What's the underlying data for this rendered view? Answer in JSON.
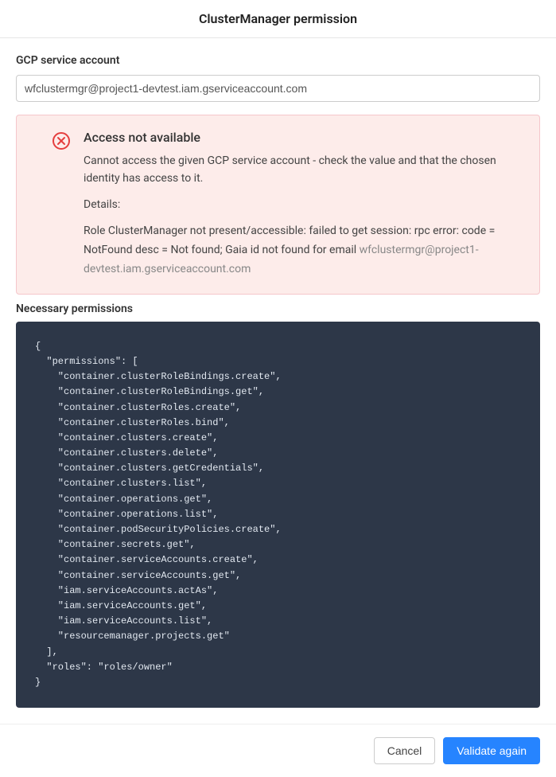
{
  "dialog": {
    "title": "ClusterManager permission"
  },
  "serviceAccount": {
    "label": "GCP service account",
    "value": "wfclustermgr@project1-devtest.iam.gserviceaccount.com"
  },
  "alert": {
    "title": "Access not available",
    "message": "Cannot access the given GCP service account - check the value and that the chosen identity has access to it.",
    "detailsLabel": "Details:",
    "detailsPrefix": "Role ClusterManager not present/accessible: failed to get session: rpc error: code = NotFound desc = Not found; Gaia id not found for email ",
    "detailsEmail": "wfclustermgr@project1-devtest.iam.gserviceaccount.com"
  },
  "permissions": {
    "label": "Necessary permissions",
    "json": {
      "permissions": [
        "container.clusterRoleBindings.create",
        "container.clusterRoleBindings.get",
        "container.clusterRoles.create",
        "container.clusterRoles.bind",
        "container.clusters.create",
        "container.clusters.delete",
        "container.clusters.getCredentials",
        "container.clusters.list",
        "container.operations.get",
        "container.operations.list",
        "container.podSecurityPolicies.create",
        "container.secrets.get",
        "container.serviceAccounts.create",
        "container.serviceAccounts.get",
        "iam.serviceAccounts.actAs",
        "iam.serviceAccounts.get",
        "iam.serviceAccounts.list",
        "resourcemanager.projects.get"
      ],
      "roles": "roles/owner"
    }
  },
  "footer": {
    "cancel": "Cancel",
    "validate": "Validate again"
  }
}
